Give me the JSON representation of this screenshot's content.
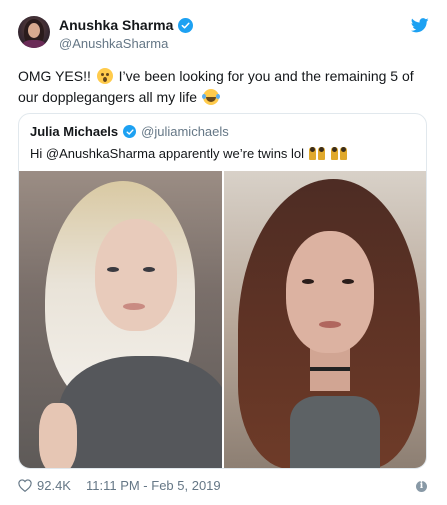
{
  "author": {
    "name": "Anushka Sharma",
    "handle": "@AnushkaSharma",
    "verified": true
  },
  "tweet": {
    "text_part1": "OMG YES!!",
    "emoji1": "astonished-face-emoji",
    "text_part2": "I’ve been looking for you and the remaining 5 of our dopplegangers all my life",
    "emoji2": "face-with-tears-of-joy-emoji"
  },
  "quoted_tweet": {
    "name": "Julia Michaels",
    "handle": "@juliamichaels",
    "verified": true,
    "text": "Hi @AnushkaSharma apparently we’re twins lol",
    "emojis": [
      "dancers-emoji",
      "dancers-emoji"
    ],
    "photos": [
      "photo-julia-michaels",
      "photo-anushka-sharma"
    ]
  },
  "footer": {
    "likes": "92.4K",
    "timestamp": "11:11 PM - Feb 5, 2019",
    "info_icon": "info-icon"
  },
  "colors": {
    "twitter_blue": "#1da1f2",
    "text": "#14171a",
    "muted": "#657786",
    "border": "#e1e8ed"
  }
}
